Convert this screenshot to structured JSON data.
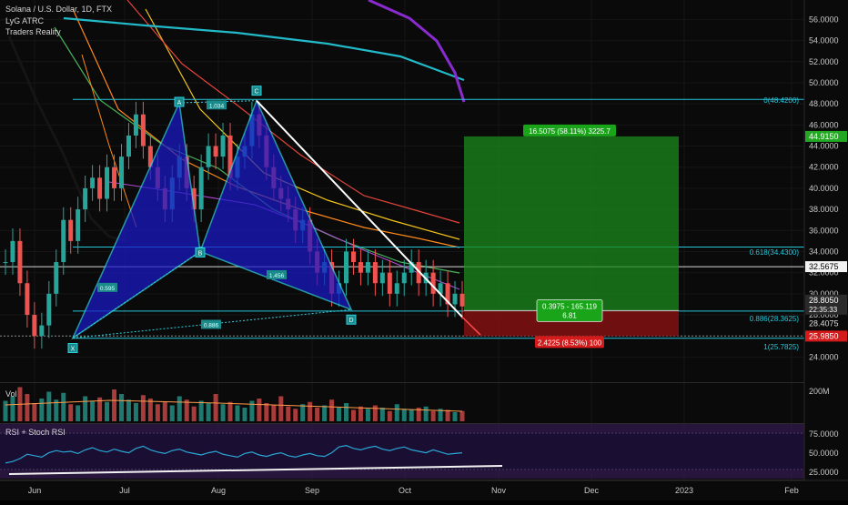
{
  "header": {
    "symbol": "Solana / U.S. Dollar, 1D, FTX",
    "indicator1": "LyG ATRC",
    "indicator2": "Traders Reality"
  },
  "volume_pane": {
    "label": "Vol",
    "axis_label": "200M"
  },
  "rsi_pane": {
    "label": "RSI + Stoch RSI",
    "ticks": [
      "75.0000",
      "50.0000",
      "25.0000"
    ]
  },
  "price_axis": {
    "ticks": [
      "56.0000",
      "54.0000",
      "52.0000",
      "50.0000",
      "48.0000",
      "46.0000",
      "44.0000",
      "42.0000",
      "40.0000",
      "38.0000",
      "36.0000",
      "34.0000",
      "32.0000",
      "30.0000",
      "28.0000",
      "26.0000",
      "24.0000"
    ],
    "tag_green": "44.9150",
    "tag_white": "32.5675",
    "tag_dark": "28.8050",
    "tag_dark_sub": "22:35:33",
    "tag_plain": "28.4075",
    "tag_red": "25.9850"
  },
  "time_axis": [
    "Jun",
    "Jul",
    "Aug",
    "Sep",
    "Oct",
    "Nov",
    "Dec",
    "2023",
    "Feb"
  ],
  "fib_labels": {
    "f0": "0(48.4200)",
    "f618": "0.618(34.4300)",
    "f886": "0.886(28.3625)",
    "f1": "1(25.7825)"
  },
  "pattern": {
    "points": [
      "X",
      "A",
      "B",
      "C",
      "D"
    ],
    "ratios": [
      "1.034",
      "0.595",
      "1.456",
      "0.886"
    ]
  },
  "position": {
    "target_label": "16.5075 (58.11%) 3225.7",
    "entry_label_1": "0.3975 - 165.119",
    "entry_label_2": "6.81",
    "stop_label": "2.4225 (8.53%) 100"
  },
  "colors": {
    "profit": "#1b8a1b",
    "loss": "#8a1010",
    "pattern": "#1a1ac8",
    "pattern_edge": "#2fd0e0",
    "fib": "#26c6da"
  },
  "chart_data": {
    "type": "line",
    "title": "Solana / U.S. Dollar, 1D, FTX",
    "xlabel": "",
    "ylabel": "",
    "x_ticks": [
      "Jun",
      "Jul",
      "Aug",
      "Sep",
      "Oct",
      "Nov",
      "Dec",
      "2023",
      "Feb"
    ],
    "ylim": [
      23,
      57.5
    ],
    "harmonic_pattern": {
      "labels": [
        "X",
        "A",
        "B",
        "C",
        "D"
      ],
      "prices": [
        25.8,
        48.1,
        34.0,
        48.3,
        28.5
      ]
    },
    "fibonacci": [
      {
        "level": "0",
        "price": 48.42
      },
      {
        "level": "0.618",
        "price": 34.43
      },
      {
        "level": "0.886",
        "price": 28.3625
      },
      {
        "level": "1",
        "price": 25.7825
      }
    ],
    "position": {
      "entry": 28.4,
      "target": 44.915,
      "stop": 25.985
    },
    "trendline": {
      "start": 48.3,
      "end": 26.3
    },
    "price_series": [
      33,
      35,
      31,
      28,
      26,
      27,
      30,
      33,
      37,
      35,
      38,
      40,
      41,
      39,
      42,
      40,
      43,
      45,
      47,
      44,
      42,
      40,
      38,
      41,
      43,
      40,
      38,
      42,
      44,
      43,
      45,
      41,
      43,
      44,
      47,
      45,
      42,
      40,
      39,
      38,
      36,
      37,
      34,
      32,
      33,
      30,
      31,
      34,
      33,
      32,
      33,
      31,
      32,
      30,
      31,
      32,
      33,
      31,
      32,
      30,
      31,
      29,
      30,
      28.8
    ],
    "volume_series": [
      18,
      22,
      30,
      24,
      16,
      20,
      26,
      19,
      25,
      15,
      14,
      22,
      18,
      21,
      17,
      28,
      24,
      19,
      16,
      23,
      20,
      15,
      17,
      14,
      22,
      19,
      13,
      18,
      16,
      24,
      15,
      17,
      14,
      12,
      18,
      20,
      16,
      14,
      22,
      13,
      11,
      15,
      17,
      12,
      14,
      19,
      12,
      16,
      10,
      13,
      11,
      14,
      12,
      9,
      15,
      11,
      10,
      12,
      13,
      9,
      11,
      10,
      8,
      9
    ],
    "rsi_series": [
      34,
      36,
      40,
      46,
      44,
      42,
      48,
      51,
      49,
      50,
      47,
      52,
      55,
      51,
      49,
      53,
      50,
      48,
      54,
      57,
      52,
      49,
      47,
      51,
      53,
      49,
      47,
      45,
      48,
      50,
      46,
      44,
      42,
      47,
      49,
      45,
      43,
      46,
      48,
      44,
      42,
      45,
      47,
      44,
      43,
      48,
      56,
      58,
      54,
      52,
      55,
      57,
      53,
      51,
      54,
      56,
      52,
      50,
      48,
      52,
      49,
      46,
      47,
      48
    ]
  }
}
